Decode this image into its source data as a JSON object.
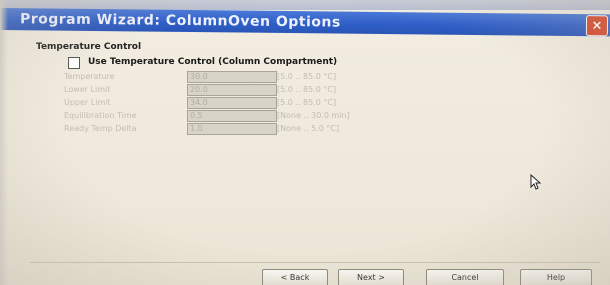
{
  "window": {
    "title": "Program Wizard: ColumnOven Options",
    "close_symbol": "×"
  },
  "temperature_control": {
    "group_label": "Temperature Control",
    "checkbox_label": "Use Temperature Control (Column Compartment)",
    "checked": false,
    "rows": [
      {
        "label": "Temperature",
        "value": "30.0",
        "range": "[5.0 .. 85.0 °C]"
      },
      {
        "label": "Lower Limit",
        "value": "20.0",
        "range": "[5.0 .. 85.0 °C]"
      },
      {
        "label": "Upper Limit",
        "value": "34.0",
        "range": "[5.0 .. 85.0 °C]"
      },
      {
        "label": "Equilibration Time",
        "value": "0.5",
        "range": "[None .. 30.0 min]"
      },
      {
        "label": "Ready Temp Delta",
        "value": "1.0",
        "range": "[None .. 5.0 °C]"
      }
    ]
  },
  "footer": {
    "back_label": "< Back",
    "next_label": "Next >",
    "cancel_label": "Cancel",
    "help_label": "Help"
  },
  "icons": {
    "close": "close-icon",
    "cursor": "mouse-pointer-icon"
  },
  "colors": {
    "titlebar": "#2f5fc8",
    "background": "#ebe5d6",
    "disabled_text": "#c2bdb0"
  }
}
